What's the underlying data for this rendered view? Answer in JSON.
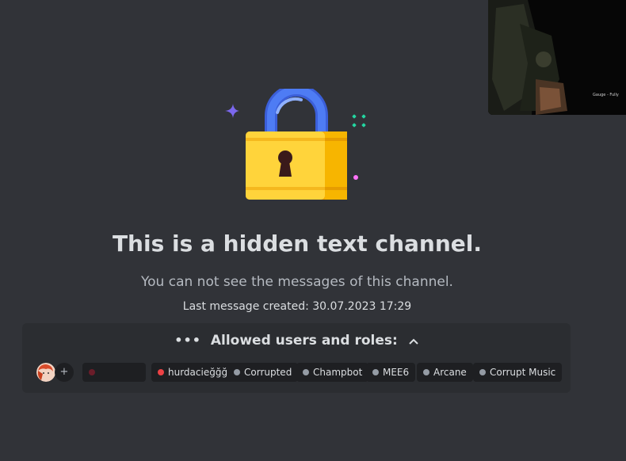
{
  "main": {
    "title": "This is a hidden text channel.",
    "subtitle": "You can not see the messages of this channel.",
    "last_message": "Last message created: 30.07.2023 17:29"
  },
  "allowed": {
    "header": "Allowed users and roles:",
    "dots_icon": "ellipsis-icon",
    "toggle_icon": "chevron-up-icon",
    "add_label": "+",
    "items": [
      {
        "label": "",
        "color": "#6b1d2a"
      },
      {
        "label": "hurdacieğğğ",
        "color": "#ed4245"
      },
      {
        "label": "Corrupted",
        "color": "#949ba4"
      },
      {
        "label": "Champbot",
        "color": "#949ba4"
      },
      {
        "label": "MEE6",
        "color": "#949ba4"
      },
      {
        "label": "Arcane",
        "color": "#949ba4"
      },
      {
        "label": "Corrupt Music",
        "color": "#949ba4"
      }
    ]
  },
  "colors": {
    "background": "#313338",
    "panel": "#2b2d31",
    "pill": "#1e1f22",
    "lock_body": "#ffd43b",
    "lock_shackle": "#4e7cf4",
    "sparkle_purple": "#7b68ee",
    "sparkle_green": "#23d5a0",
    "sparkle_pink": "#ff73fa"
  },
  "video_overlay": {
    "caption": "Gauge - Fully"
  }
}
